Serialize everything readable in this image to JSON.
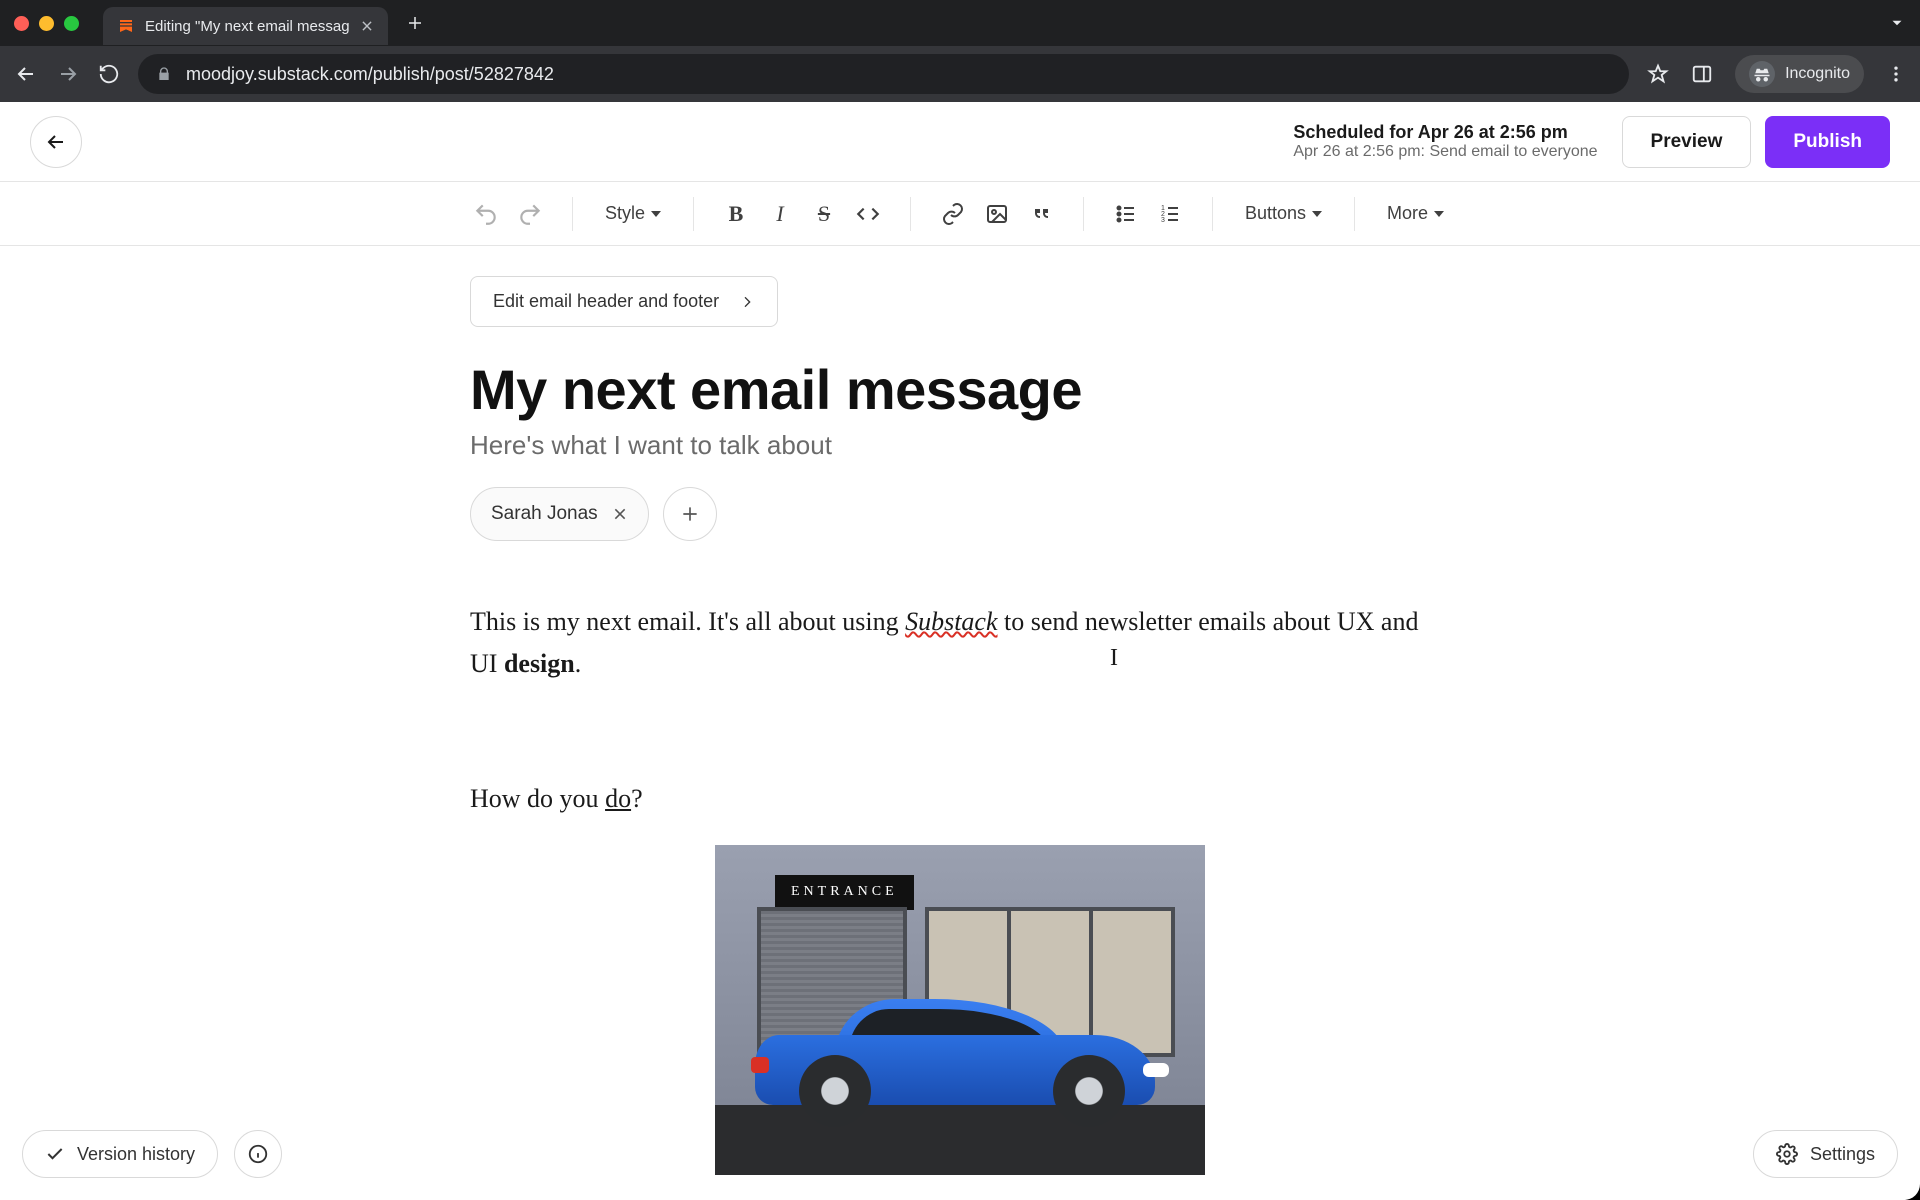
{
  "browser": {
    "tab_title": "Editing \"My next email messag",
    "url": "moodjoy.substack.com/publish/post/52827842",
    "incognito_label": "Incognito"
  },
  "header": {
    "scheduled_line1": "Scheduled for Apr 26 at 2:56 pm",
    "scheduled_line2": "Apr 26 at 2:56 pm: Send email to everyone",
    "preview_label": "Preview",
    "publish_label": "Publish"
  },
  "toolbar": {
    "style_label": "Style",
    "buttons_label": "Buttons",
    "more_label": "More"
  },
  "editor": {
    "edit_header_footer_label": "Edit email header and footer",
    "title": "My next email message",
    "subtitle": "Here's what I want to talk about",
    "author_chip": "Sarah Jonas",
    "body": {
      "p1_pre": "This is my next email. It's all about using ",
      "p1_wavy": "Substack",
      "p1_mid": " to send newsletter emails about UX and UI ",
      "p1_bold": "design",
      "p1_post": ".",
      "p2_pre": "How do you ",
      "p2_u": "do",
      "p2_post": "?"
    },
    "image_caption_sign": "ENTRANCE"
  },
  "footer": {
    "version_history_label": "Version history",
    "settings_label": "Settings"
  }
}
